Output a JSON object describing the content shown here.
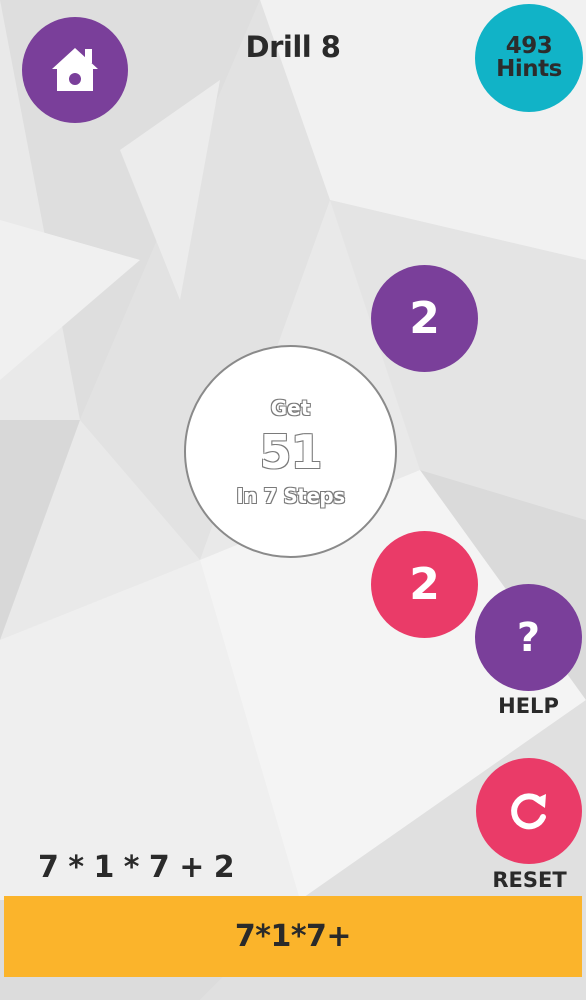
{
  "header": {
    "title": "Drill 8",
    "hints_count": "493",
    "hints_label": "Hints"
  },
  "target": {
    "prefix": "Get",
    "number": "51",
    "suffix": "In 7 Steps"
  },
  "numbers": [
    {
      "value": "2",
      "color": "#7a3f9a"
    },
    {
      "value": "2",
      "color": "#ea3b68"
    }
  ],
  "help": {
    "icon_text": "?",
    "label": "HELP"
  },
  "reset": {
    "label": "RESET"
  },
  "expression": "7 * 1 * 7 + 2",
  "bottom_bar": {
    "text": "7*1*7+"
  },
  "colors": {
    "purple": "#7a3f9a",
    "teal": "#11b3c7",
    "pink": "#ea3b68",
    "yellow": "#fbb42b"
  },
  "icons": {
    "home": "home-icon",
    "reset": "refresh-icon"
  }
}
